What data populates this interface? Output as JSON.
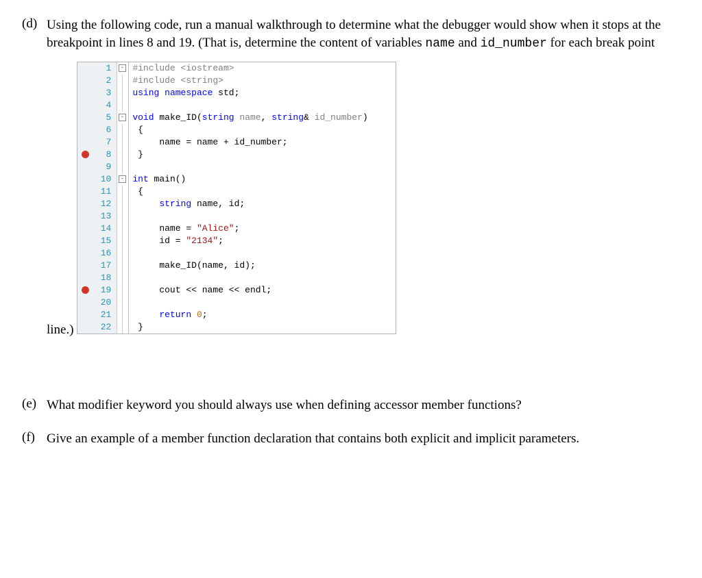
{
  "q_d": {
    "label": "(d)",
    "text_pre": "Using the following code, run a manual walkthrough to determine what the debugger would show when it stops at the breakpoint in lines 8 and 19. (That is, determine the content of variables ",
    "var1": "name",
    "text_mid": " and ",
    "var2": "id_number",
    "text_post": " for each break point line.)"
  },
  "q_e": {
    "label": "(e)",
    "text": "What modifier keyword you should always use when defining accessor member functions?"
  },
  "q_f": {
    "label": "(f)",
    "text": "Give an example of a member function declaration that contains both explicit and implicit parameters."
  },
  "code": {
    "lines": [
      {
        "n": "1",
        "bp": false,
        "fold": "minus",
        "tokens": [
          [
            "pre",
            "#include <iostream>"
          ]
        ]
      },
      {
        "n": "2",
        "bp": false,
        "fold": "bar",
        "tokens": [
          [
            "pre",
            "#include <string>"
          ]
        ]
      },
      {
        "n": "3",
        "bp": false,
        "fold": "bar",
        "tokens": [
          [
            "kw",
            "using"
          ],
          [
            "id",
            " "
          ],
          [
            "kw",
            "namespace"
          ],
          [
            "id",
            " std;"
          ]
        ]
      },
      {
        "n": "4",
        "bp": false,
        "fold": "bar",
        "tokens": []
      },
      {
        "n": "5",
        "bp": false,
        "fold": "minus",
        "tokens": [
          [
            "kw",
            "void"
          ],
          [
            "id",
            " make_ID("
          ],
          [
            "kw",
            "string"
          ],
          [
            "id",
            " "
          ],
          [
            "gray",
            "name"
          ],
          [
            "id",
            ", "
          ],
          [
            "kw",
            "string"
          ],
          [
            "id",
            "& "
          ],
          [
            "gray",
            "id_number"
          ],
          [
            "id",
            ")"
          ]
        ]
      },
      {
        "n": "6",
        "bp": false,
        "fold": "bar",
        "tokens": [
          [
            "id",
            " {"
          ]
        ]
      },
      {
        "n": "7",
        "bp": false,
        "fold": "bar",
        "tokens": [
          [
            "id",
            "     name = name + id_number;"
          ]
        ]
      },
      {
        "n": "8",
        "bp": true,
        "fold": "bar",
        "tokens": [
          [
            "id",
            " }"
          ]
        ]
      },
      {
        "n": "9",
        "bp": false,
        "fold": "bar",
        "tokens": []
      },
      {
        "n": "10",
        "bp": false,
        "fold": "minus",
        "tokens": [
          [
            "kw",
            "int"
          ],
          [
            "id",
            " main()"
          ]
        ]
      },
      {
        "n": "11",
        "bp": false,
        "fold": "bar",
        "tokens": [
          [
            "id",
            " {"
          ]
        ]
      },
      {
        "n": "12",
        "bp": false,
        "fold": "bar",
        "tokens": [
          [
            "id",
            "     "
          ],
          [
            "kw",
            "string"
          ],
          [
            "id",
            " name, id;"
          ]
        ]
      },
      {
        "n": "13",
        "bp": false,
        "fold": "bar",
        "tokens": []
      },
      {
        "n": "14",
        "bp": false,
        "fold": "bar",
        "tokens": [
          [
            "id",
            "     name = "
          ],
          [
            "str",
            "\"Alice\""
          ],
          [
            "id",
            ";"
          ]
        ]
      },
      {
        "n": "15",
        "bp": false,
        "fold": "bar",
        "tokens": [
          [
            "id",
            "     id = "
          ],
          [
            "str",
            "\"2134\""
          ],
          [
            "id",
            ";"
          ]
        ]
      },
      {
        "n": "16",
        "bp": false,
        "fold": "bar",
        "tokens": []
      },
      {
        "n": "17",
        "bp": false,
        "fold": "bar",
        "tokens": [
          [
            "id",
            "     make_ID(name, id);"
          ]
        ]
      },
      {
        "n": "18",
        "bp": false,
        "fold": "bar",
        "tokens": []
      },
      {
        "n": "19",
        "bp": true,
        "fold": "bar",
        "tokens": [
          [
            "id",
            "     cout << name << endl;"
          ]
        ]
      },
      {
        "n": "20",
        "bp": false,
        "fold": "bar",
        "tokens": []
      },
      {
        "n": "21",
        "bp": false,
        "fold": "bar",
        "tokens": [
          [
            "id",
            "     "
          ],
          [
            "kw",
            "return"
          ],
          [
            "id",
            " "
          ],
          [
            "num",
            "0"
          ],
          [
            "id",
            ";"
          ]
        ]
      },
      {
        "n": "22",
        "bp": false,
        "fold": "bar",
        "tokens": [
          [
            "id",
            " }"
          ]
        ]
      }
    ]
  }
}
